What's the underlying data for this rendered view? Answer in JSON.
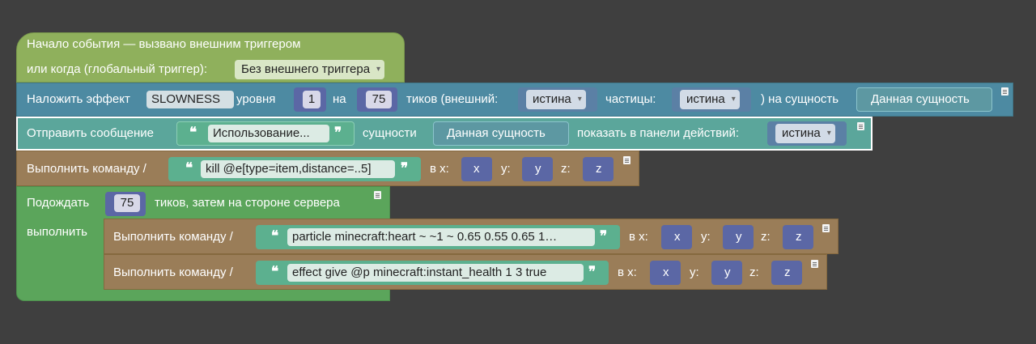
{
  "colors": {
    "background": "#3f3f3f",
    "event": "#8fb05c",
    "potion": "#4d8aa2",
    "message": "#5ba69b",
    "command": "#9a7d58",
    "wait": "#5ba55b",
    "string": "#5cb08f",
    "number": "#5b67a5",
    "entity": "#5d98a2",
    "logic": "#5b80a5"
  },
  "event_block": {
    "line1": "Начало события — вызвано внешним триггером",
    "line2": "или когда (глобальный триггер):",
    "trigger": "Без внешнего триггера"
  },
  "potion_block": {
    "t1": "Наложить эффект",
    "effect": "SLOWNESS",
    "t2": "уровня",
    "level": "1",
    "t3": "на",
    "duration": "75",
    "t4": "тиков (внешний:",
    "ambient": "истина",
    "t5": "частицы:",
    "particles": "истина",
    "t6": ") на сущность",
    "entity": "Данная сущность"
  },
  "message_block": {
    "t1": "Отправить сообщение",
    "message": "Использование...",
    "t2": "сущности",
    "entity": "Данная сущность",
    "t3": "показать в панели действий:",
    "actionbar": "истина"
  },
  "command_block_1": {
    "t1": "Выполнить команду /",
    "command": "kill @e[type=item,distance=..5]",
    "tx": "в x:",
    "x": "x",
    "ty": "y:",
    "y": "y",
    "tz": "z:",
    "z": "z"
  },
  "wait_block": {
    "t1": "Подождать",
    "ticks": "75",
    "t2": "тиков, затем на стороне сервера",
    "t3": "выполнить"
  },
  "command_block_2": {
    "t1": "Выполнить команду /",
    "command": "particle minecraft:heart ~ ~1 ~ 0.65 0.55 0.65 1…",
    "tx": "в x:",
    "x": "x",
    "ty": "y:",
    "y": "y",
    "tz": "z:",
    "z": "z"
  },
  "command_block_3": {
    "t1": "Выполнить команду /",
    "command": "effect give @p minecraft:instant_health 1 3 true",
    "tx": "в x:",
    "x": "x",
    "ty": "y:",
    "y": "y",
    "tz": "z:",
    "z": "z"
  },
  "quote_glyphs": {
    "open": "❝",
    "close": "❞"
  },
  "dropdown_arrow": "▾"
}
